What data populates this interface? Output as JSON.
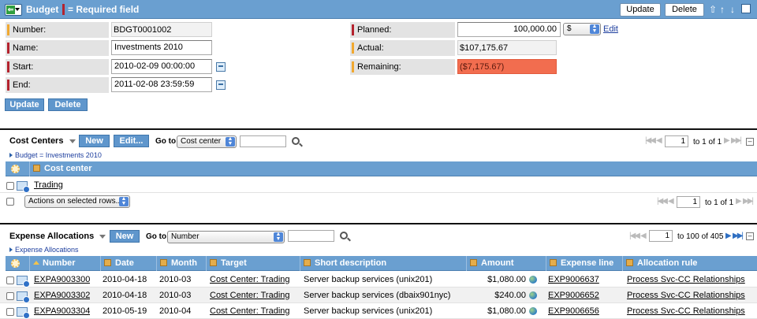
{
  "header": {
    "title": "Budget",
    "required_label": "= Required field",
    "update_label": "Update",
    "delete_label": "Delete"
  },
  "form": {
    "number_label": "Number:",
    "number_value": "BDGT0001002",
    "name_label": "Name:",
    "name_value": "Investments 2010",
    "start_label": "Start:",
    "start_value": "2010-02-09 00:00:00",
    "end_label": "End:",
    "end_value": "2011-02-08 23:59:59",
    "planned_label": "Planned:",
    "planned_value": "100,000.00",
    "currency": "$",
    "edit_label": "Edit",
    "actual_label": "Actual:",
    "actual_value": "$107,175.67",
    "remaining_label": "Remaining:",
    "remaining_value": "($7,175.67)",
    "update_label": "Update",
    "delete_label": "Delete",
    "colors": {
      "required_mark": "#b4232e",
      "readonly_mark": "#f0a830",
      "remaining_bg": "#f26d4f",
      "accent": "#6a9fd0"
    }
  },
  "cost_centers": {
    "title": "Cost Centers",
    "new_label": "New",
    "edit_label": "Edit...",
    "goto_label": "Go to",
    "goto_select": "Cost center",
    "breadcrumb": "Budget = Investments 2010",
    "page_input": "1",
    "page_text": "to 1 of 1",
    "column": "Cost center",
    "rows": [
      {
        "name": "Trading"
      }
    ],
    "actions_select": "Actions on selected rows...",
    "footer_page_input": "1",
    "footer_page_text": "to 1 of 1"
  },
  "expense_allocations": {
    "title": "Expense Allocations",
    "new_label": "New",
    "goto_label": "Go to",
    "goto_select": "Number",
    "breadcrumb": "Expense Allocations",
    "page_input": "1",
    "page_text": "to 100 of 405",
    "columns": [
      "Number",
      "Date",
      "Month",
      "Target",
      "Short description",
      "Amount",
      "Expense line",
      "Allocation rule"
    ],
    "rows": [
      {
        "number": "EXPA9003300",
        "date": "2010-04-18",
        "month": "2010-03",
        "target": "Cost Center: Trading",
        "description": "Server backup services (unix201)",
        "amount": "$1,080.00",
        "expense_line": "EXP9006637",
        "rule": "Process Svc-CC Relationships"
      },
      {
        "number": "EXPA9003302",
        "date": "2010-04-18",
        "month": "2010-03",
        "target": "Cost Center: Trading",
        "description": "Server backup services (dbaix901nyc)",
        "amount": "$240.00",
        "expense_line": "EXP9006652",
        "rule": "Process Svc-CC Relationships"
      },
      {
        "number": "EXPA9003304",
        "date": "2010-05-19",
        "month": "2010-04",
        "target": "Cost Center: Trading",
        "description": "Server backup services (unix201)",
        "amount": "$1,080.00",
        "expense_line": "EXP9006656",
        "rule": "Process Svc-CC Relationships"
      }
    ]
  }
}
